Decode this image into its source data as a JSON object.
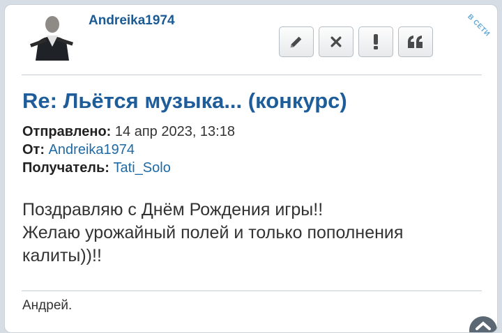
{
  "post": {
    "author": "Andreika1974",
    "online_badge": "В СЕТИ",
    "title": "Re: Льётся музыка... (конкурс)",
    "meta": {
      "sent_label": "Отправлено:",
      "sent_value": "14 апр 2023, 13:18",
      "from_label": "От:",
      "from_value": "Andreika1974",
      "to_label": "Получатель:",
      "to_value": "Tati_Solo"
    },
    "body_lines": [
      "Поздравляю с Днём Рождения игры!!",
      "Желаю урожайный полей и только пополнения",
      "калиты))!!"
    ],
    "signature": "Андрей."
  },
  "toolbar": {
    "icons": [
      "pencil-icon",
      "close-icon",
      "exclamation-icon",
      "quote-icon"
    ]
  },
  "colors": {
    "accent": "#1e5d99",
    "link": "#1e6aa6",
    "online": "#62a8d8"
  }
}
